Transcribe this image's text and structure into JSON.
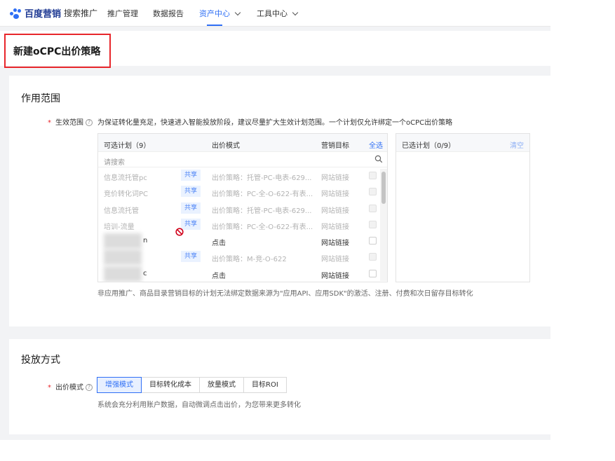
{
  "nav": {
    "brand": "百度营销",
    "sub": "搜索推广",
    "items": [
      {
        "label": "推广管理",
        "has_chevron": false,
        "active": false
      },
      {
        "label": "数据报告",
        "has_chevron": false,
        "active": false
      },
      {
        "label": "资产中心",
        "has_chevron": true,
        "active": true
      },
      {
        "label": "工具中心",
        "has_chevron": true,
        "active": false
      }
    ]
  },
  "page": {
    "title": "新建oCPC出价策略"
  },
  "scope": {
    "section_title": "作用范围",
    "field_label": "生效范围",
    "field_desc": "为保证转化量充足，快速进入智能投放阶段，建议尽量扩大生效计划范围。一个计划仅允许绑定一个oCPC出价策略",
    "table": {
      "col_available": "可选计划（9）",
      "col_mode": "出价模式",
      "col_goal": "营销目标",
      "select_all": "全选",
      "search_placeholder": "请搜索",
      "rows": [
        {
          "name": "信息流托管pc",
          "tag": "共享",
          "mode": "出价策略：托管-PC-电表-629...",
          "goal": "网站链接",
          "disabled": true
        },
        {
          "name": "竞价转化词PC",
          "tag": "共享",
          "mode": "出价策略：PC-全-O-622-有表...",
          "goal": "网站链接",
          "disabled": true
        },
        {
          "name": "信息流托管",
          "tag": "共享",
          "mode": "出价策略：托管-PC-电表-629...",
          "goal": "网站链接",
          "disabled": true
        },
        {
          "name": "培训-流量",
          "tag": "共享",
          "mode": "出价策略：PC-全-O-622-有表...",
          "goal": "网站链接",
          "disabled": true
        },
        {
          "name": "n",
          "tag": "",
          "mode": "点击",
          "goal": "网站链接",
          "disabled": false,
          "blurred": true
        },
        {
          "name": "",
          "tag": "共享",
          "mode": "出价策略：M-竞-O-622",
          "goal": "网站链接",
          "disabled": true,
          "blurred": true
        },
        {
          "name": "c",
          "tag": "",
          "mode": "点击",
          "goal": "网站链接",
          "disabled": false,
          "blurred": true
        }
      ]
    },
    "selected": {
      "title": "已选计划（0/9）",
      "clear": "清空"
    },
    "note": "非应用推广、商品目录营销目标的计划无法绑定数据来源为\"应用API、应用SDK\"的激活、注册、付费和次日留存目标转化"
  },
  "delivery": {
    "section_title": "投放方式",
    "field_label": "出价模式",
    "modes": [
      "增强模式",
      "目标转化成本",
      "放量模式",
      "目标ROI"
    ],
    "active_mode": "增强模式",
    "mode_desc": "系统会充分利用账户数据，自动微调点击出价，为您带来更多转化"
  },
  "colors": {
    "accent": "#2f6ff5",
    "highlight_border": "#e8262b",
    "required": "#e8262b"
  },
  "icons": {
    "help": "question-circle-icon",
    "search": "search-icon",
    "forbid": "no-entry-icon",
    "chevron": "chevron-down-icon"
  }
}
